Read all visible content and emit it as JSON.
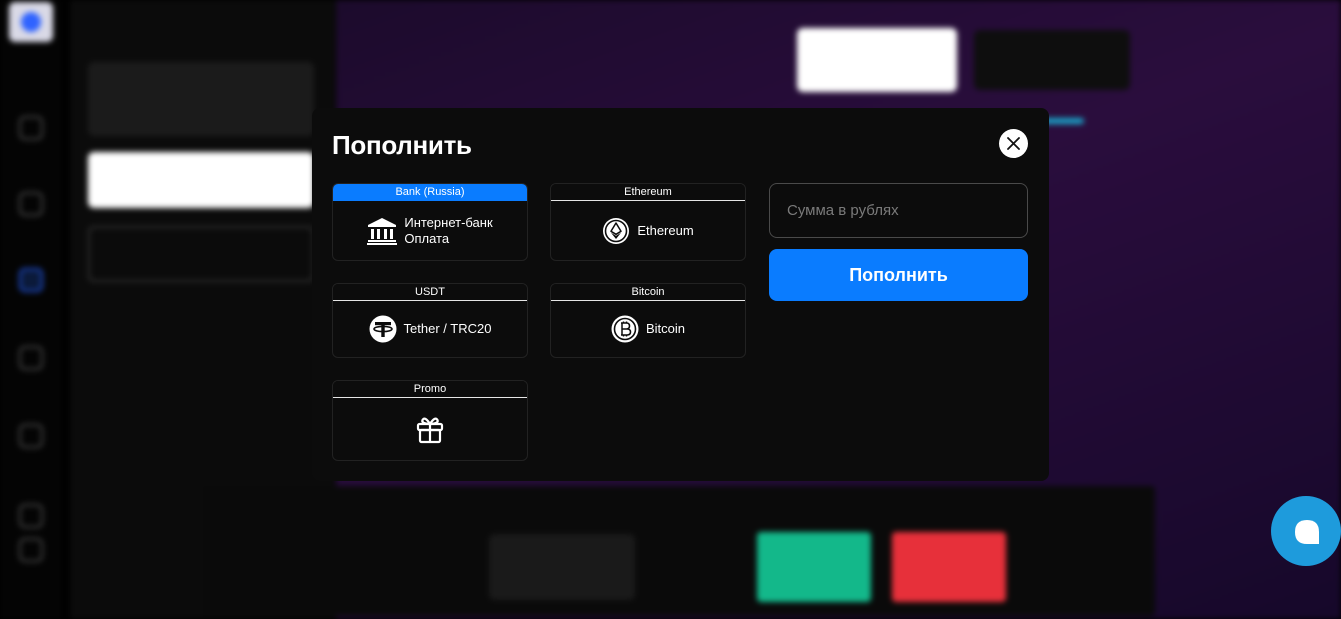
{
  "modal": {
    "title": "Пополнить",
    "methods": [
      {
        "category": "Bank (Russia)",
        "label_line1": "Интернет-банк",
        "label_line2": "Оплата",
        "icon": "bank-icon",
        "selected": true
      },
      {
        "category": "Ethereum",
        "label": "Ethereum",
        "icon": "ethereum-icon",
        "selected": false
      },
      {
        "category": "USDT",
        "label": "Tether / TRC20",
        "icon": "tether-icon",
        "selected": false
      },
      {
        "category": "Bitcoin",
        "label": "Bitcoin",
        "icon": "bitcoin-icon",
        "selected": false
      },
      {
        "category": "Promo",
        "label": "",
        "icon": "gift-icon",
        "selected": false
      }
    ],
    "amount_placeholder": "Сумма в рублях",
    "submit_label": "Пополнить"
  },
  "colors": {
    "accent": "#0a7cff",
    "modal_bg": "#0c0c0c",
    "chat": "#1e9bdc"
  }
}
